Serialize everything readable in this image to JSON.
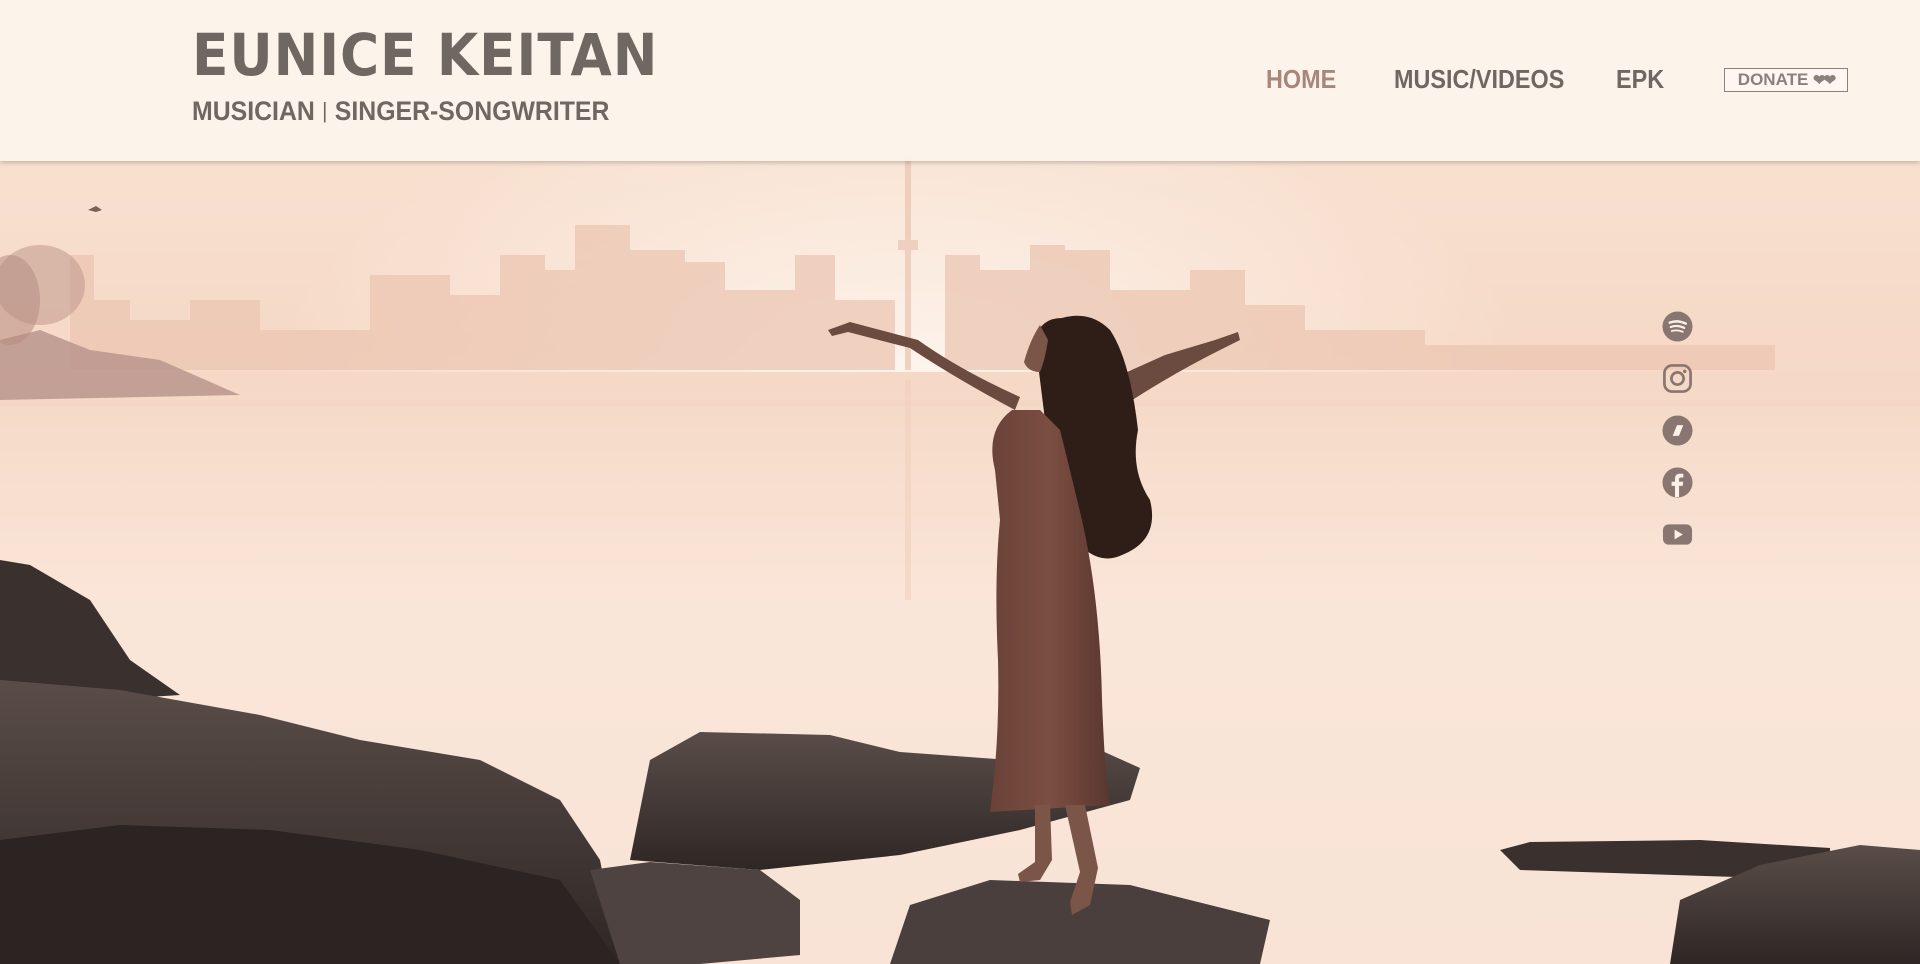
{
  "header": {
    "brand_title": "EUNICE KEITAN",
    "brand_subtitle_left": "MUSICIAN",
    "brand_subtitle_separator": "|",
    "brand_subtitle_right": "SINGER-SONGWRITER"
  },
  "nav": {
    "items": [
      {
        "label": "HOME",
        "active": true
      },
      {
        "label": "MUSIC/VIDEOS",
        "active": false
      },
      {
        "label": "EPK",
        "active": false
      }
    ],
    "donate_label": "DONATE",
    "donate_hearts": "❤❤"
  },
  "social": {
    "icons": [
      "spotify-icon",
      "instagram-icon",
      "bandcamp-icon",
      "facebook-icon",
      "youtube-icon"
    ]
  },
  "colors": {
    "text_dark": "#6f6761",
    "nav_active": "#a8877a",
    "header_bg": "#fcf4ec",
    "sky": "#f7dccb",
    "icon": "#8a7670"
  }
}
